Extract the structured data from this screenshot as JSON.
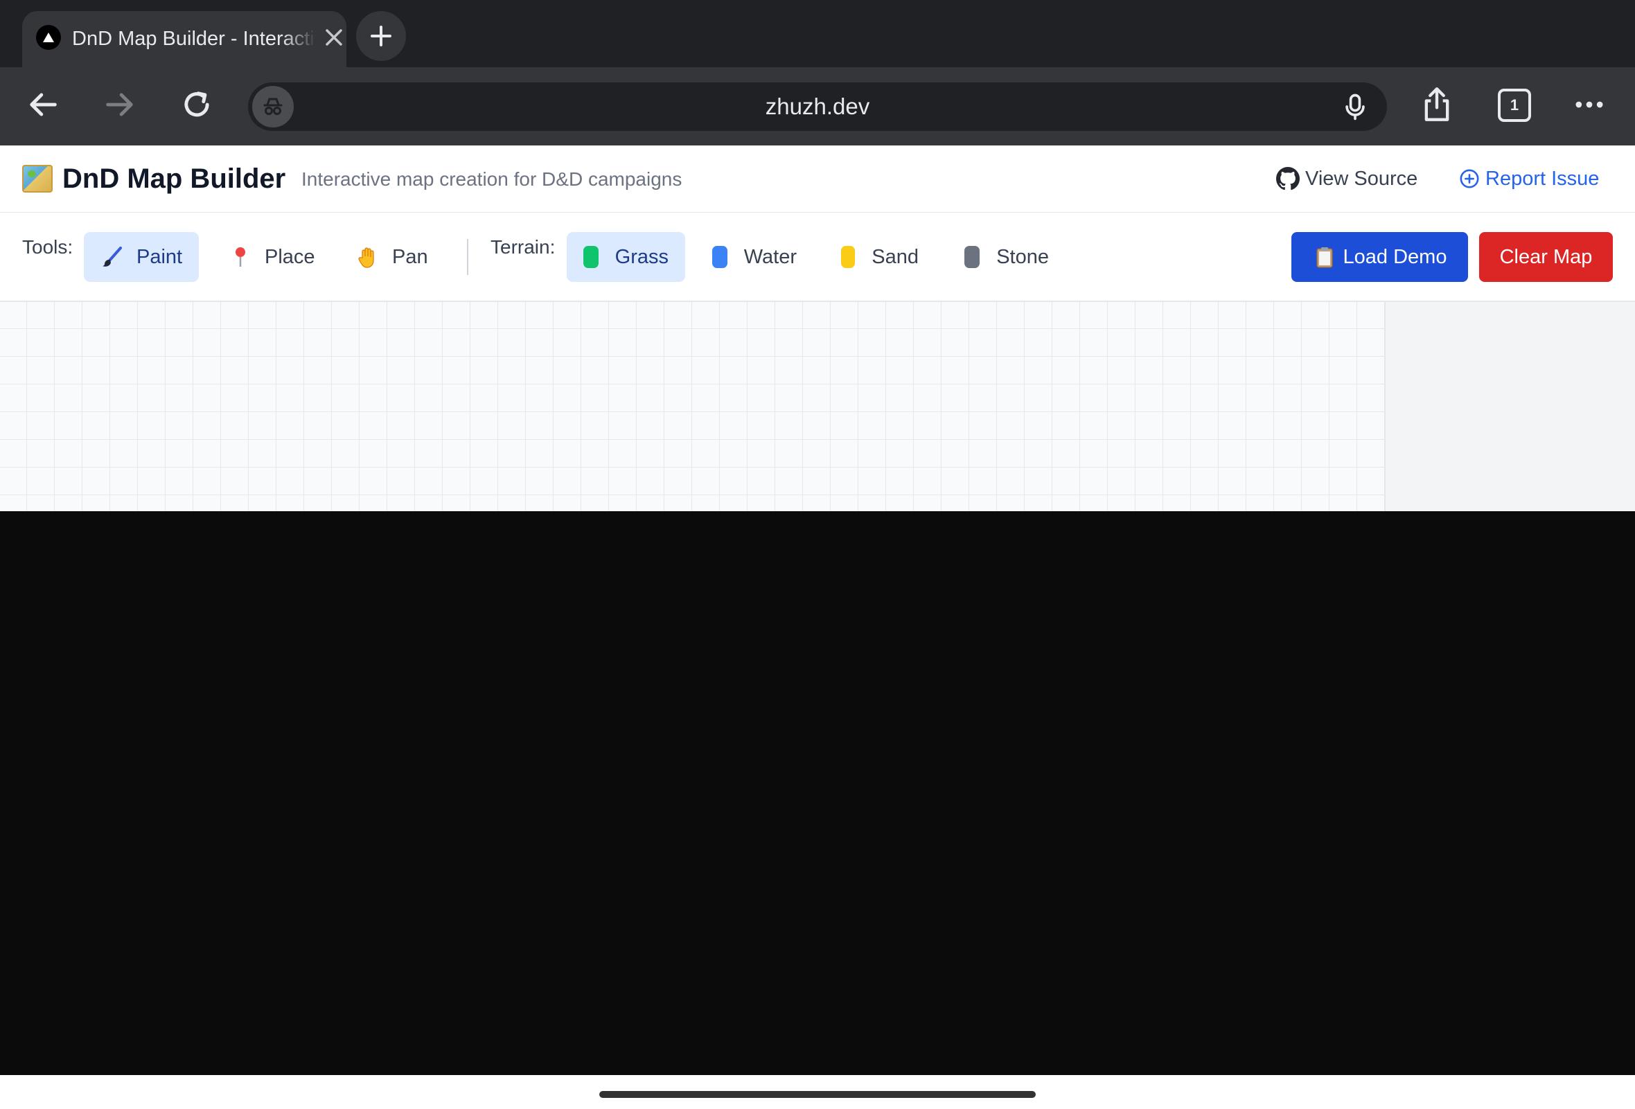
{
  "browser": {
    "tab_title": "DnD Map Builder - Interactive Map Builder",
    "url": "zhuzh.dev",
    "tab_count": "1"
  },
  "header": {
    "title": "DnD Map Builder",
    "subtitle": "Interactive map creation for D&D campaigns",
    "view_source": "View Source",
    "report_issue": "Report Issue"
  },
  "toolbar": {
    "tools_label": "Tools:",
    "tools": [
      {
        "label": "Paint",
        "icon": "paintbrush-icon",
        "active": true
      },
      {
        "label": "Place",
        "icon": "pin-icon",
        "active": false
      },
      {
        "label": "Pan",
        "icon": "hand-icon",
        "active": false
      }
    ],
    "terrain_label": "Terrain:",
    "terrains": [
      {
        "label": "Grass",
        "color": "#10c46b",
        "active": true
      },
      {
        "label": "Water",
        "color": "#3b82f6",
        "active": false
      },
      {
        "label": "Sand",
        "color": "#facc15",
        "active": false
      },
      {
        "label": "Stone",
        "color": "#6b7280",
        "active": false
      }
    ],
    "load_demo": "Load Demo",
    "clear_map": "Clear Map"
  },
  "colors": {
    "accent": "#1d4ed8",
    "danger": "#dc2626",
    "link": "#2563eb"
  }
}
